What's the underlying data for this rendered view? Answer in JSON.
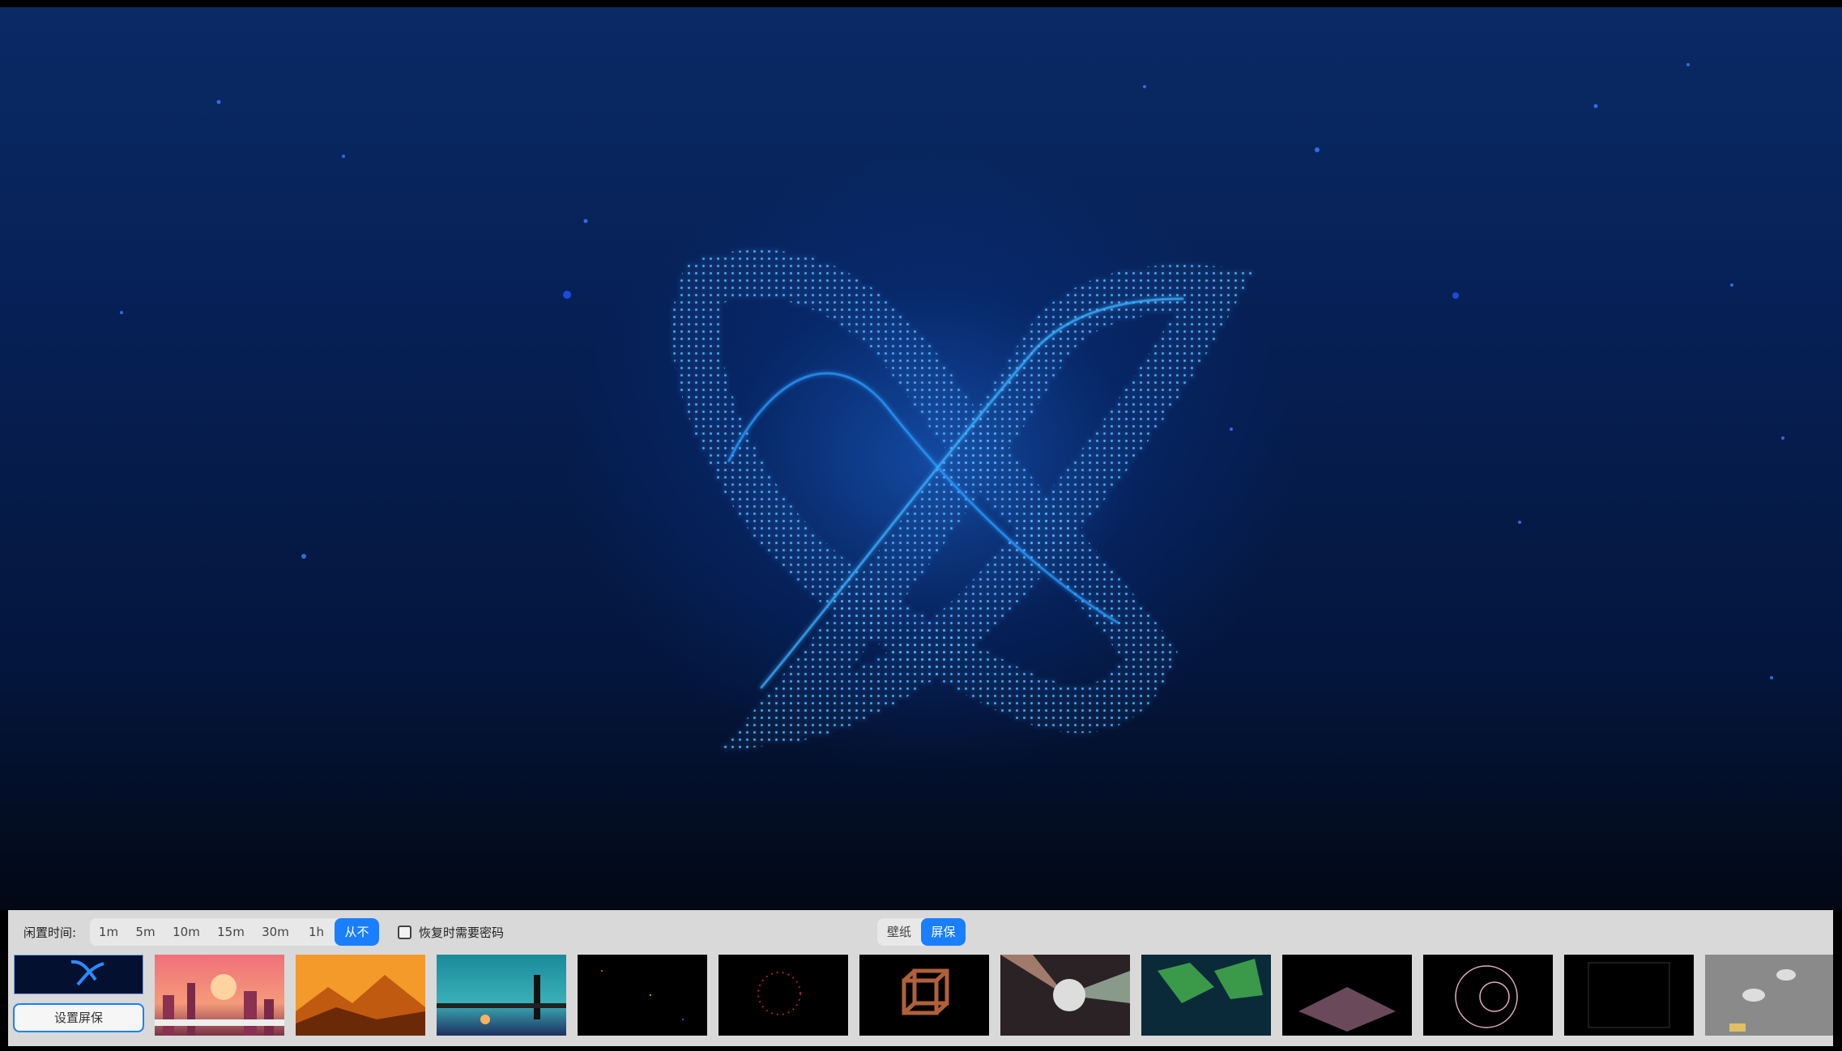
{
  "idle_time": {
    "label": "闲置时间:",
    "options": [
      "1m",
      "5m",
      "10m",
      "15m",
      "30m",
      "1h",
      "从不"
    ],
    "selected": "从不"
  },
  "lock_option": {
    "label": "恢复时需要密码",
    "checked": false
  },
  "mode_switch": {
    "options": [
      "壁纸",
      "屏保"
    ],
    "selected": "屏保"
  },
  "set_button_label": "设置屏保",
  "colors": {
    "accent": "#1a7fff",
    "panel_bg": "#d9d9d9"
  },
  "thumbnails": [
    {
      "name": "deepin-logo-blue",
      "selected": true
    },
    {
      "name": "city-sunset-train"
    },
    {
      "name": "orange-mountains"
    },
    {
      "name": "lighthouse-bridge"
    },
    {
      "name": "starfield-dark"
    },
    {
      "name": "particle-sphere"
    },
    {
      "name": "wire-cube"
    },
    {
      "name": "disco-ball-rays"
    },
    {
      "name": "green-map-tiles"
    },
    {
      "name": "pink-grid-particles"
    },
    {
      "name": "glowing-rings"
    },
    {
      "name": "wire-box-dark"
    },
    {
      "name": "gray-toy-objects"
    }
  ]
}
